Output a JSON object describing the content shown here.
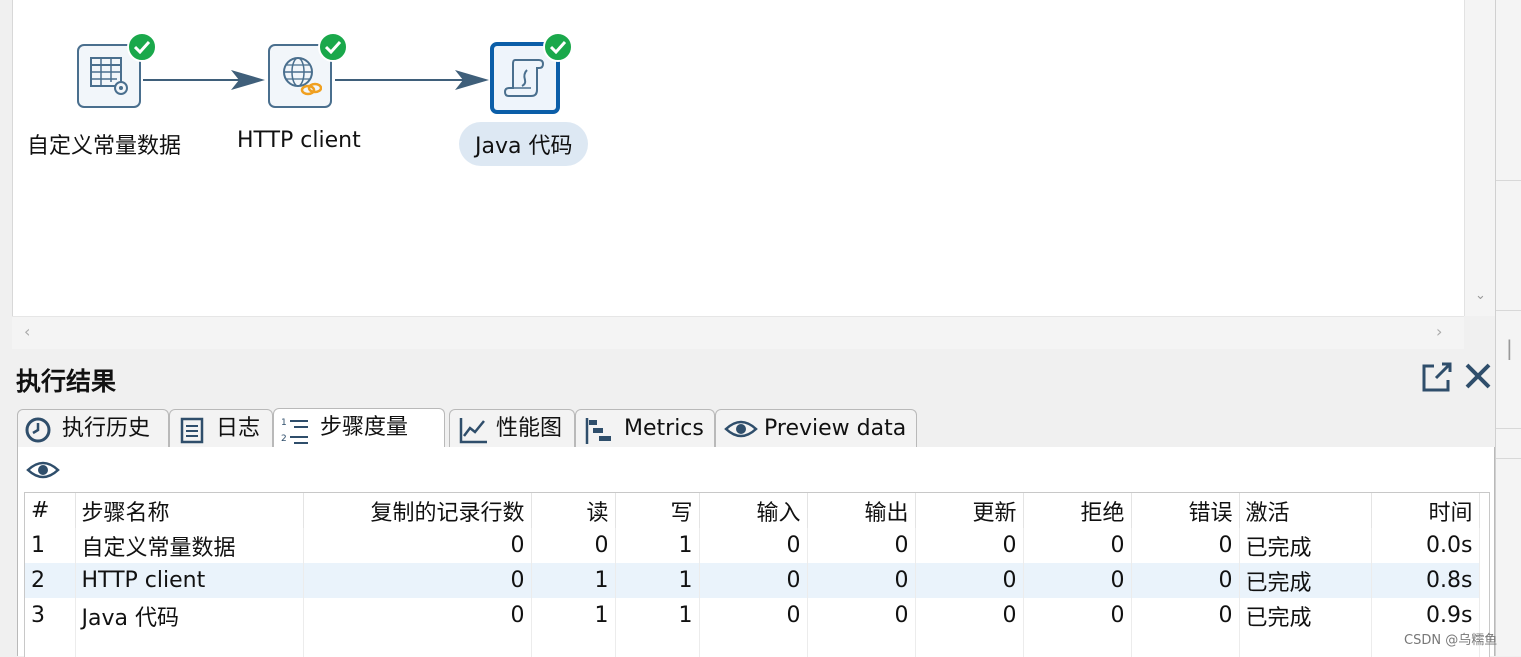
{
  "canvas": {
    "steps": [
      {
        "label": "自定义常量数据",
        "status_icon": "check-icon",
        "icon": "data-grid-gear-icon"
      },
      {
        "label": "HTTP client",
        "status_icon": "check-icon",
        "icon": "globe-link-icon"
      },
      {
        "label": "Java 代码",
        "status_icon": "check-icon",
        "icon": "script-scroll-icon",
        "selected": true
      }
    ],
    "colors": {
      "hop": "#3f5f7a",
      "check": "#1aa84b",
      "selected_border": "#0b5ea8"
    }
  },
  "panel": {
    "title": "执行结果",
    "tabs": [
      {
        "label": "执行历史",
        "icon": "clock-icon"
      },
      {
        "label": "日志",
        "icon": "log-doc-icon"
      },
      {
        "label": "步骤度量",
        "icon": "numbered-list-icon",
        "active": true
      },
      {
        "label": "性能图",
        "icon": "line-chart-icon"
      },
      {
        "label": "Metrics",
        "icon": "gantt-icon"
      },
      {
        "label": "Preview data",
        "icon": "eye-icon"
      }
    ]
  },
  "table": {
    "columns": [
      "#",
      "步骤名称",
      "复制的记录行数",
      "读",
      "写",
      "输入",
      "输出",
      "更新",
      "拒绝",
      "错误",
      "激活",
      "时间"
    ],
    "rows": [
      [
        "1",
        "自定义常量数据",
        "0",
        "0",
        "1",
        "0",
        "0",
        "0",
        "0",
        "0",
        "已完成",
        "0.0s"
      ],
      [
        "2",
        "HTTP client",
        "0",
        "1",
        "1",
        "0",
        "0",
        "0",
        "0",
        "0",
        "已完成",
        "0.8s"
      ],
      [
        "3",
        "Java 代码",
        "0",
        "1",
        "1",
        "0",
        "0",
        "0",
        "0",
        "0",
        "已完成",
        "0.9s"
      ]
    ]
  },
  "watermark": "CSDN @乌糯鱼"
}
